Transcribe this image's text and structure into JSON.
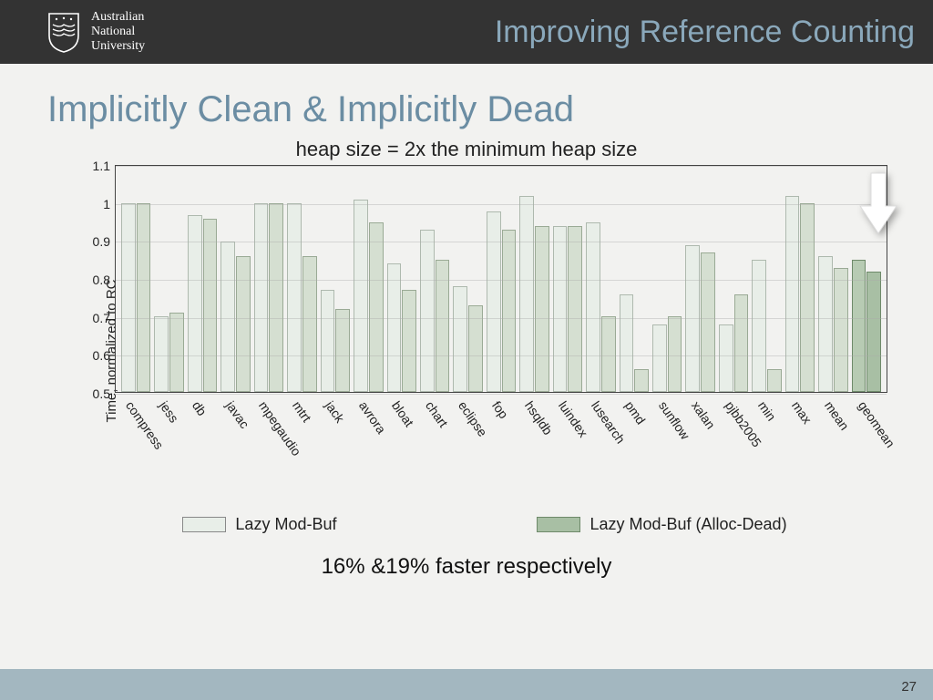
{
  "header": {
    "institution_line1": "Australian",
    "institution_line2": "National",
    "institution_line3": "University",
    "title": "Improving Reference Counting"
  },
  "slide": {
    "title": "Implicitly Clean & Implicitly Dead",
    "callout": "16% &19% faster respectively",
    "page_number": "27"
  },
  "legend": {
    "series1": "Lazy Mod-Buf",
    "series2": "Lazy Mod-Buf (Alloc-Dead)"
  },
  "chart_data": {
    "type": "bar",
    "title": "heap size = 2x the minimum heap size",
    "ylabel": "Time, normalized to RC",
    "xlabel": "",
    "ylim": [
      0.5,
      1.1
    ],
    "yticks": [
      0.5,
      0.6,
      0.7,
      0.8,
      0.9,
      1.0,
      1.1
    ],
    "categories": [
      "compress",
      "jess",
      "db",
      "javac",
      "mpegaudio",
      "mtrt",
      "jack",
      "avrora",
      "bloat",
      "chart",
      "eclipse",
      "fop",
      "hsqldb",
      "luindex",
      "lusearch",
      "pmd",
      "sunflow",
      "xalan",
      "pjbb2005",
      "min",
      "max",
      "mean",
      "geomean"
    ],
    "emphasized_category": "geomean",
    "series": [
      {
        "name": "Lazy Mod-Buf",
        "values": [
          1.0,
          0.7,
          0.97,
          0.9,
          1.0,
          1.0,
          0.77,
          1.01,
          0.84,
          0.93,
          0.78,
          0.98,
          1.02,
          0.94,
          0.95,
          0.76,
          0.68,
          0.89,
          0.68,
          0.85,
          1.02,
          0.86,
          0.85
        ]
      },
      {
        "name": "Lazy Mod-Buf (Alloc-Dead)",
        "values": [
          1.0,
          0.71,
          0.96,
          0.86,
          1.0,
          0.86,
          0.72,
          0.95,
          0.77,
          0.85,
          0.73,
          0.93,
          0.94,
          0.94,
          0.7,
          0.56,
          0.7,
          0.87,
          0.76,
          0.56,
          1.0,
          0.83,
          0.82
        ]
      }
    ]
  }
}
